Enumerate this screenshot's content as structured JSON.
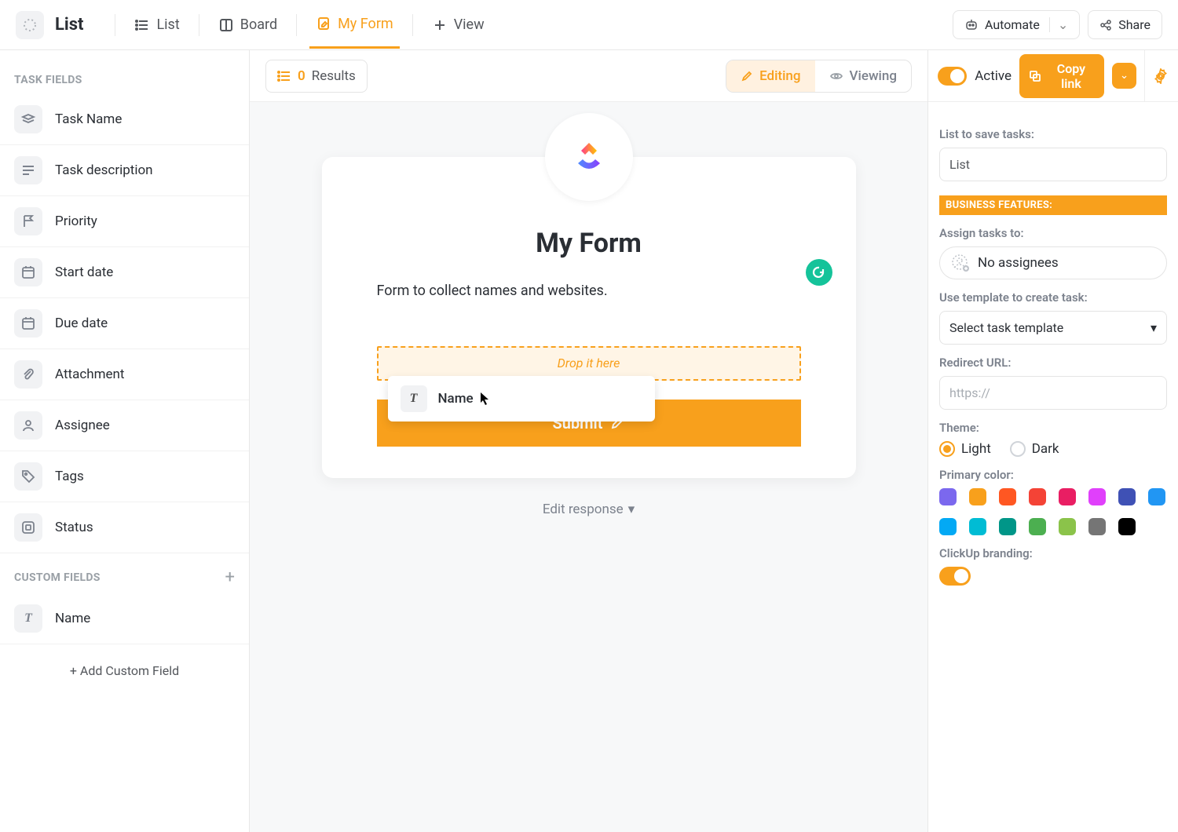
{
  "topbar": {
    "title": "List",
    "tabs": {
      "list": "List",
      "board": "Board",
      "myform": "My Form",
      "view": "View"
    },
    "automate": "Automate",
    "share": "Share"
  },
  "canvas_toolbar": {
    "results_count": "0",
    "results_label": "Results",
    "editing": "Editing",
    "viewing": "Viewing"
  },
  "rightbar_top": {
    "active": "Active",
    "copy_link": "Copy link"
  },
  "sidebar": {
    "task_fields_title": "TASK FIELDS",
    "fields": {
      "task_name": "Task Name",
      "task_description": "Task description",
      "priority": "Priority",
      "start_date": "Start date",
      "due_date": "Due date",
      "attachment": "Attachment",
      "assignee": "Assignee",
      "tags": "Tags",
      "status": "Status"
    },
    "custom_fields_title": "CUSTOM FIELDS",
    "custom_fields": {
      "name": "Name"
    },
    "add_custom": "+ Add Custom Field"
  },
  "form": {
    "title": "My Form",
    "description": "Form to collect names and websites.",
    "drop_hint": "Drop it here",
    "drag_label": "Name",
    "submit": "Submit",
    "edit_response": "Edit response"
  },
  "config": {
    "list_to_save_label": "List to save tasks:",
    "list_value": "List",
    "biz_badge": "BUSINESS FEATURES:",
    "assign_label": "Assign tasks to:",
    "no_assignees": "No assignees",
    "template_label": "Use template to create task:",
    "template_value": "Select task template",
    "redirect_label": "Redirect URL:",
    "redirect_placeholder": "https://",
    "theme_label": "Theme:",
    "theme_light": "Light",
    "theme_dark": "Dark",
    "primary_color_label": "Primary color:",
    "colors": [
      "#7b68ee",
      "#f8a01c",
      "#ff5722",
      "#f44336",
      "#e91e63",
      "#e040fb",
      "#3f51b5",
      "#2196f3",
      "#03a9f4",
      "#00bcd4",
      "#009688",
      "#4caf50",
      "#8bc34a",
      "#757575",
      "#000000"
    ],
    "branding_label": "ClickUp branding:"
  }
}
